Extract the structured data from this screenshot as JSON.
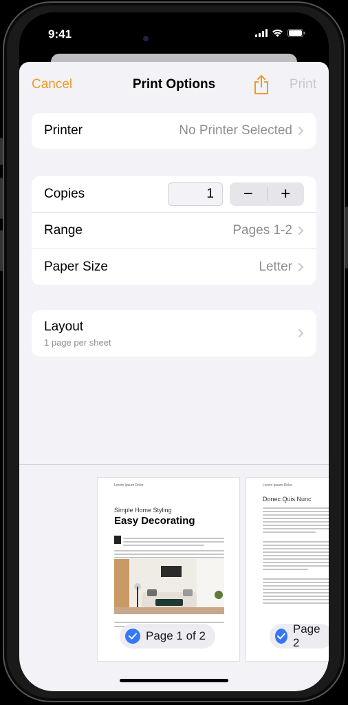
{
  "status": {
    "time": "9:41"
  },
  "nav": {
    "cancel": "Cancel",
    "title": "Print Options",
    "print": "Print",
    "share_icon": "share-icon",
    "accent": "#ef9a24"
  },
  "printer": {
    "label": "Printer",
    "value": "No Printer Selected"
  },
  "copies": {
    "label": "Copies",
    "value": "1",
    "minus": "−",
    "plus": "+"
  },
  "range": {
    "label": "Range",
    "value": "Pages 1-2"
  },
  "paper_size": {
    "label": "Paper Size",
    "value": "Letter"
  },
  "layout": {
    "label": "Layout",
    "sub": "1 page per sheet"
  },
  "preview": {
    "page1": {
      "header": "Lorem Ipsum Dolor",
      "kicker": "Simple Home Styling",
      "title": "Easy Decorating",
      "badge": "Page 1 of 2"
    },
    "page2": {
      "header": "Lorem Ipsum Dolor",
      "title": "Donec Quis Nunc",
      "badge": "Page 2"
    }
  }
}
